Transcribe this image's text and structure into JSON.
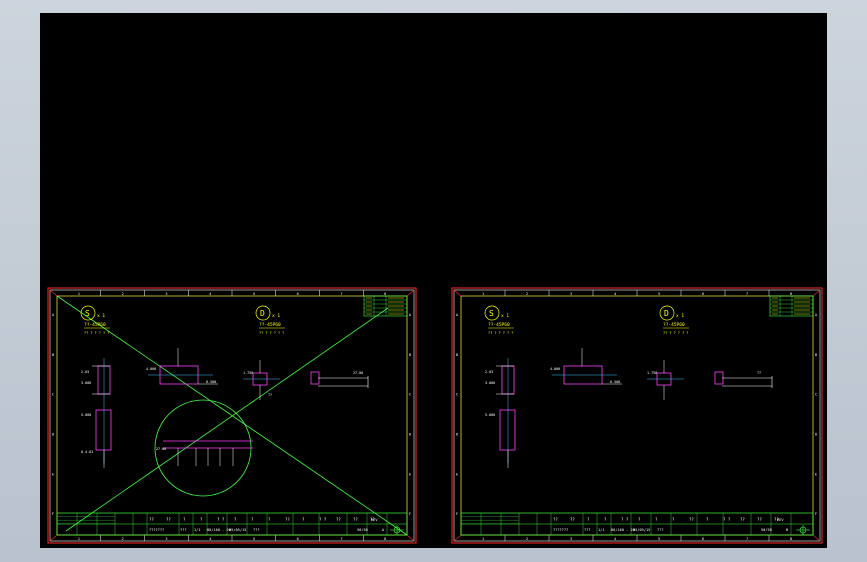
{
  "colors": {
    "viewport_bg": "#000000",
    "border_red": "#ff2a2a",
    "border_white": "#ffffff",
    "frame_yellow": "#ffff40",
    "line_green": "#40ff40",
    "part_magenta": "#ff40ff",
    "dim_white": "#ffffff",
    "label_yellow": "#ffff00",
    "axis_cyan": "#40c0ff"
  },
  "icons": {
    "origin": "crosshair-origin-icon"
  },
  "sheets": [
    {
      "views": [
        {
          "letter": "S",
          "qty": "x 1",
          "material": "??-45P60",
          "note": "?? ? ? ? ? ?"
        },
        {
          "letter": "D",
          "qty": "x 1",
          "material": "??-45P60",
          "note": "?? ? ? ? ? ?"
        }
      ],
      "dims": [
        "2.03",
        "3.000",
        "5.000",
        "4.000",
        "0.500",
        "1.750",
        "27.00",
        "0.4.02",
        "??"
      ],
      "title_block": {
        "row1": [
          "??",
          "??",
          "?",
          "?",
          "? ?",
          "?",
          "?",
          "?",
          "??",
          "?",
          "? ?",
          "??",
          "??",
          "??"
        ],
        "row2": [
          "???????",
          "???",
          "1/1",
          "80/160 - 20",
          "05/05/15",
          "???",
          "50/50",
          "A"
        ],
        "rev_label": "REV"
      },
      "zone_numbers": [
        "1",
        "2",
        "3",
        "4",
        "5",
        "6",
        "7",
        "8"
      ],
      "zone_letters": [
        "A",
        "B",
        "C",
        "D",
        "E",
        "F"
      ]
    },
    {
      "views": [
        {
          "letter": "S",
          "qty": "x 1",
          "material": "??-45P60",
          "note": "?? ? ? ? ? ?"
        },
        {
          "letter": "D",
          "qty": "x 1",
          "material": "??-45P60",
          "note": "?? ? ? ? ? ?"
        }
      ],
      "dims": [
        "2.03",
        "3.000",
        "5.000",
        "4.000",
        "0.500",
        "1.750",
        "??"
      ],
      "title_block": {
        "row1": [
          "??",
          "??",
          "?",
          "?",
          "? ?",
          "?",
          "?",
          "?",
          "??",
          "?",
          "? ?",
          "??",
          "??",
          "??"
        ],
        "row2": [
          "???????",
          "???",
          "1/1",
          "80/160 - 20",
          "05/05/15",
          "???",
          "50/50",
          "B"
        ],
        "rev_label": "REV"
      },
      "zone_numbers": [
        "1",
        "2",
        "3",
        "4",
        "5",
        "6",
        "7",
        "8"
      ],
      "zone_letters": [
        "A",
        "B",
        "C",
        "D",
        "E",
        "F"
      ]
    }
  ]
}
